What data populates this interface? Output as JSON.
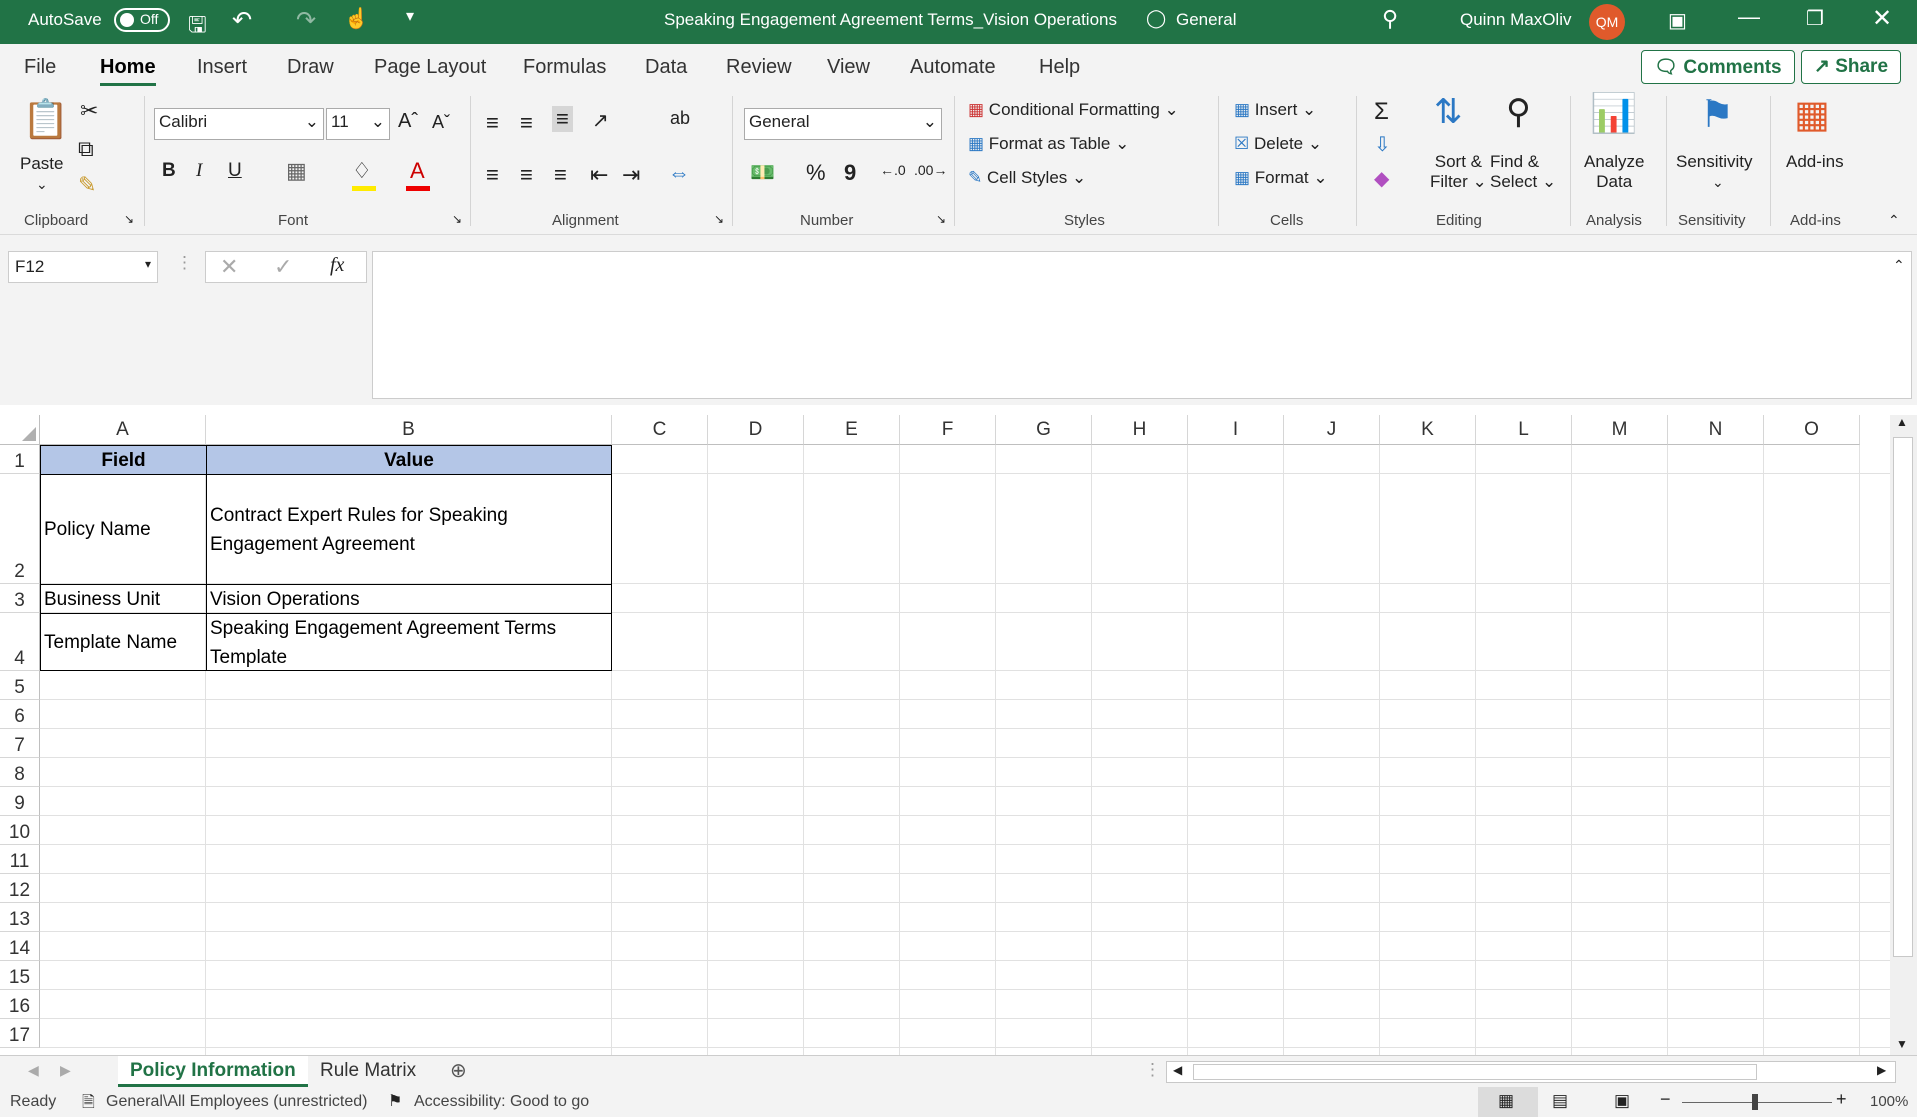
{
  "titlebar": {
    "autosave_label": "AutoSave",
    "autosave_state": "Off",
    "doc_title": "Speaking Engagement Agreement Terms_Vision Operations",
    "sensitivity": "General",
    "user_name": "Quinn MaxOliv",
    "user_initials": "QM"
  },
  "menu": {
    "tabs": [
      "File",
      "Home",
      "Insert",
      "Draw",
      "Page Layout",
      "Formulas",
      "Data",
      "Review",
      "View",
      "Automate",
      "Help"
    ],
    "active_tab": "Home",
    "comments_label": "Comments",
    "share_label": "Share"
  },
  "ribbon": {
    "clipboard": {
      "paste_label": "Paste",
      "group_label": "Clipboard"
    },
    "font": {
      "font_name": "Calibri",
      "font_size": "11",
      "bold": "B",
      "italic": "I",
      "underline": "U",
      "group_label": "Font"
    },
    "alignment": {
      "group_label": "Alignment"
    },
    "number": {
      "format": "General",
      "percent": "%",
      "comma": "9",
      "group_label": "Number"
    },
    "styles": {
      "conditional_formatting": "Conditional Formatting",
      "format_as_table": "Format as Table",
      "cell_styles": "Cell Styles",
      "group_label": "Styles"
    },
    "cells": {
      "insert": "Insert",
      "delete": "Delete",
      "format": "Format",
      "group_label": "Cells"
    },
    "editing": {
      "sort_filter_1": "Sort &",
      "sort_filter_2": "Filter",
      "find_select_1": "Find &",
      "find_select_2": "Select",
      "group_label": "Editing"
    },
    "analysis": {
      "analyze_1": "Analyze",
      "analyze_2": "Data",
      "group_label": "Analysis"
    },
    "sensitivity": {
      "label": "Sensitivity",
      "group_label": "Sensitivity"
    },
    "addins": {
      "label": "Add-ins",
      "group_label": "Add-ins"
    }
  },
  "formula_bar": {
    "name_box": "F12",
    "fx": "fx",
    "content": ""
  },
  "sheet": {
    "columns": [
      "A",
      "B",
      "C",
      "D",
      "E",
      "F",
      "G",
      "H",
      "I",
      "J",
      "K",
      "L",
      "M",
      "N",
      "O"
    ],
    "rows": [
      "1",
      "2",
      "3",
      "4",
      "5",
      "6",
      "7",
      "8",
      "9",
      "10",
      "11",
      "12",
      "13",
      "14",
      "15",
      "16",
      "17"
    ],
    "header": {
      "field": "Field",
      "value": "Value"
    },
    "data": [
      {
        "field": "Policy Name",
        "value_line1": "Contract Expert Rules for Speaking",
        "value_line2": "Engagement Agreement"
      },
      {
        "field": "Business Unit",
        "value_line1": "Vision Operations",
        "value_line2": ""
      },
      {
        "field": "Template Name",
        "value_line1": "Speaking Engagement Agreement Terms",
        "value_line2": "Template"
      }
    ]
  },
  "sheet_tabs": {
    "tabs": [
      "Policy Information",
      "Rule Matrix"
    ],
    "active": "Policy Information"
  },
  "status_bar": {
    "mode": "Ready",
    "sensitivity": "General\\All Employees (unrestricted)",
    "accessibility": "Accessibility: Good to go",
    "zoom": "100%"
  },
  "colors": {
    "brand": "#217346",
    "header_fill": "#b4c6e7",
    "avatar": "#e05a2b"
  }
}
